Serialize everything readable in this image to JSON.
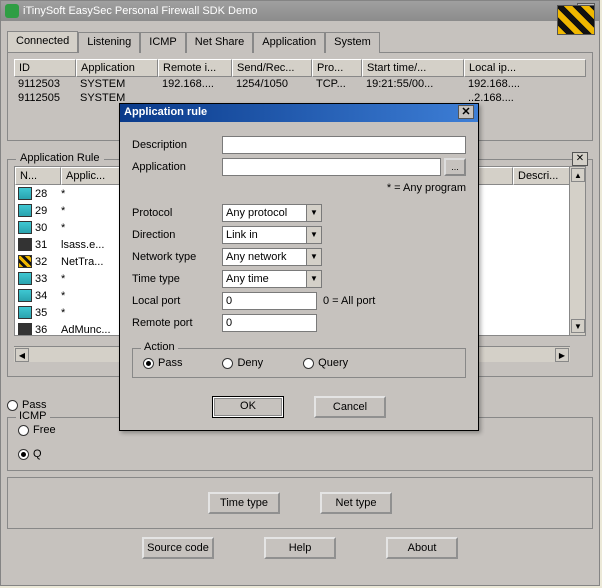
{
  "window": {
    "title": "iTinySoft EasySec Personal Firewall SDK Demo"
  },
  "tabs": [
    "Connected",
    "Listening",
    "ICMP",
    "Net Share",
    "Application",
    "System"
  ],
  "connectedHeaders": {
    "id": "ID",
    "app": "Application",
    "remote": "Remote i...",
    "sendrec": "Send/Rec...",
    "pro": "Pro...",
    "start": "Start time/...",
    "local": "Local ip..."
  },
  "connectedRows": [
    {
      "id": "9112503",
      "app": "SYSTEM",
      "remote": "192.168....",
      "sendrec": "1254/1050",
      "pro": "TCP...",
      "start": "19:21:55/00...",
      "local": "192.168...."
    },
    {
      "id": "9112505",
      "app": "SYSTEM",
      "remote": "",
      "sendrec": "",
      "pro": "",
      "start": "",
      "local": "..2.168...."
    }
  ],
  "ruleGroup": {
    "title": "Application Rule",
    "hdr": {
      "n": "N...",
      "app": "Applic...",
      "desc": "Descri..."
    },
    "rows": [
      {
        "cls": "teal",
        "n": "28",
        "app": "*"
      },
      {
        "cls": "teal",
        "n": "29",
        "app": "*"
      },
      {
        "cls": "teal",
        "n": "30",
        "app": "*"
      },
      {
        "cls": "dk",
        "n": "31",
        "app": "lsass.e..."
      },
      {
        "cls": "or",
        "n": "32",
        "app": "NetTra..."
      },
      {
        "cls": "teal",
        "n": "33",
        "app": "*"
      },
      {
        "cls": "teal",
        "n": "34",
        "app": "*"
      },
      {
        "cls": "teal",
        "n": "35",
        "app": "*"
      },
      {
        "cls": "dk",
        "n": "36",
        "app": "AdMunc..."
      }
    ]
  },
  "dialog": {
    "title": "Application rule",
    "labels": {
      "description": "Description",
      "application": "Application",
      "anyProgram": "* = Any program",
      "protocol": "Protocol",
      "direction": "Direction",
      "network": "Network type",
      "time": "Time type",
      "localPort": "Local port",
      "remotePort": "Remote port",
      "allPort": "0 = All port",
      "action": "Action",
      "pass": "Pass",
      "deny": "Deny",
      "query": "Query",
      "ok": "OK",
      "cancel": "Cancel",
      "browse": "..."
    },
    "values": {
      "description": "",
      "application": "",
      "protocol": "Any protocol",
      "direction": "Link in",
      "network": "Any network",
      "time": "Any time",
      "localPort": "0",
      "remotePort": "0"
    }
  },
  "icmp": {
    "legend": "ICMP",
    "free": "Free",
    "q": "Q"
  },
  "mainButtons": {
    "timeType": "Time type",
    "netType": "Net type",
    "source": "Source code",
    "help": "Help",
    "about": "About"
  },
  "adhoc": {
    "pass": "Pass"
  }
}
